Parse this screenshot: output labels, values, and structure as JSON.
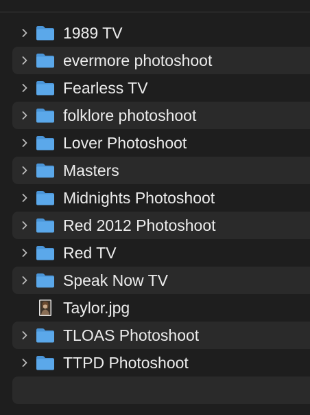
{
  "items": [
    {
      "name": "1989 TV",
      "kind": "folder",
      "icon": "folder-icon"
    },
    {
      "name": "evermore photoshoot",
      "kind": "folder",
      "icon": "folder-icon"
    },
    {
      "name": "Fearless TV",
      "kind": "folder",
      "icon": "folder-icon"
    },
    {
      "name": "folklore photoshoot",
      "kind": "folder",
      "icon": "folder-icon"
    },
    {
      "name": "Lover Photoshoot",
      "kind": "folder",
      "icon": "folder-icon"
    },
    {
      "name": "Masters",
      "kind": "folder",
      "icon": "folder-icon"
    },
    {
      "name": "Midnights Photoshoot",
      "kind": "folder",
      "icon": "folder-icon"
    },
    {
      "name": "Red 2012 Photoshoot",
      "kind": "folder",
      "icon": "folder-icon"
    },
    {
      "name": "Red TV",
      "kind": "folder",
      "icon": "folder-icon"
    },
    {
      "name": "Speak Now TV",
      "kind": "folder",
      "icon": "folder-icon"
    },
    {
      "name": "Taylor.jpg",
      "kind": "image",
      "icon": "image-file-icon"
    },
    {
      "name": "TLOAS Photoshoot",
      "kind": "folder",
      "icon": "folder-icon"
    },
    {
      "name": "TTPD Photoshoot",
      "kind": "folder",
      "icon": "folder-icon"
    }
  ],
  "colors": {
    "background": "#1e1e1e",
    "alt_row": "#2a2a2a",
    "text": "#ececec",
    "chevron": "#bdbdbd",
    "folder_front": "#5ba8ea",
    "folder_back": "#4a95d8"
  }
}
